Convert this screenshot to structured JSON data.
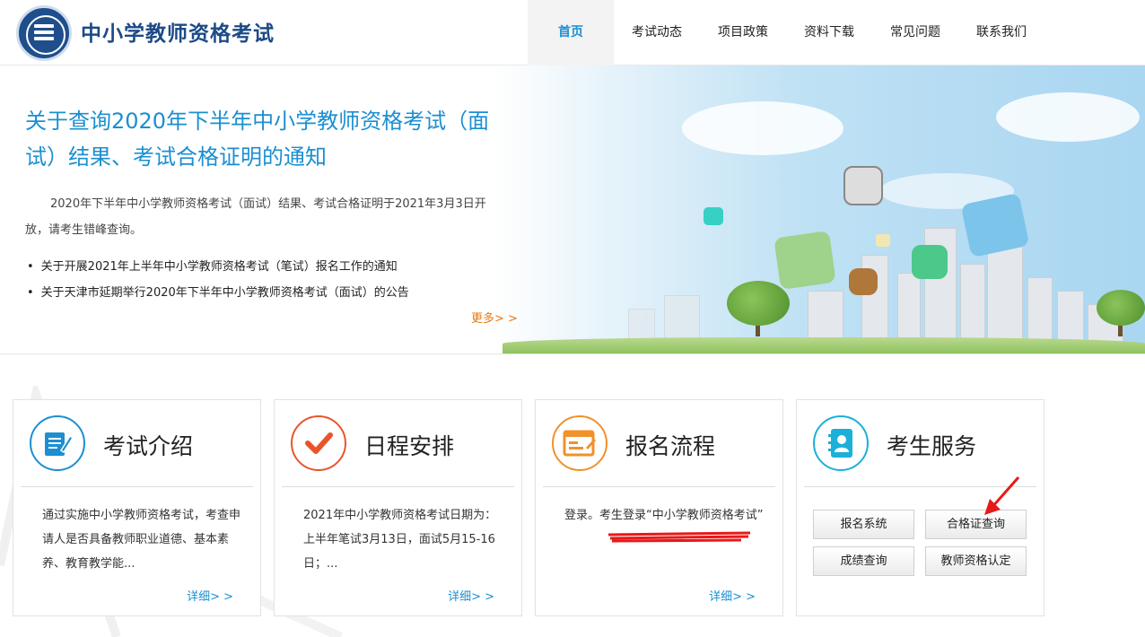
{
  "header": {
    "site_title": "中小学教师资格考试",
    "nav": [
      {
        "label": "首页",
        "active": true
      },
      {
        "label": "考试动态",
        "active": false
      },
      {
        "label": "项目政策",
        "active": false
      },
      {
        "label": "资料下载",
        "active": false
      },
      {
        "label": "常见问题",
        "active": false
      },
      {
        "label": "联系我们",
        "active": false
      }
    ]
  },
  "banner": {
    "title": "关于查询2020年下半年中小学教师资格考试（面试）结果、考试合格证明的通知",
    "desc": "2020年下半年中小学教师资格考试（面试）结果、考试合格证明于2021年3月3日开放，请考生错峰查询。",
    "news": [
      "关于开展2021年上半年中小学教师资格考试（笔试）报名工作的通知",
      "关于天津市延期举行2020年下半年中小学教师资格考试（面试）的公告"
    ],
    "more": "更多> >"
  },
  "cards": [
    {
      "title": "考试介绍",
      "icon": "document-edit-icon",
      "color": "#1b8fd1",
      "text": "通过实施中小学教师资格考试，考查申请人是否具备教师职业道德、基本素养、教育教学能...",
      "link": "详细> >"
    },
    {
      "title": "日程安排",
      "icon": "checkmark-icon",
      "color": "#e8552a",
      "text": "2021年中小学教师资格考试日期为：上半年笔试3月13日，面试5月15-16日；...",
      "link": "详细> >"
    },
    {
      "title": "报名流程",
      "icon": "form-window-icon",
      "color": "#f0912a",
      "text": "登录。考生登录“中小学教师资格考试”",
      "link": "详细> >"
    },
    {
      "title": "考生服务",
      "icon": "contact-book-icon",
      "color": "#1bb0d8",
      "buttons": [
        "报名系统",
        "合格证查询",
        "成绩查询",
        "教师资格认定"
      ]
    }
  ],
  "colors": {
    "brand": "#1c4a86",
    "accent": "#1b8fd1",
    "more": "#e8780f",
    "annotation": "#e81919"
  }
}
